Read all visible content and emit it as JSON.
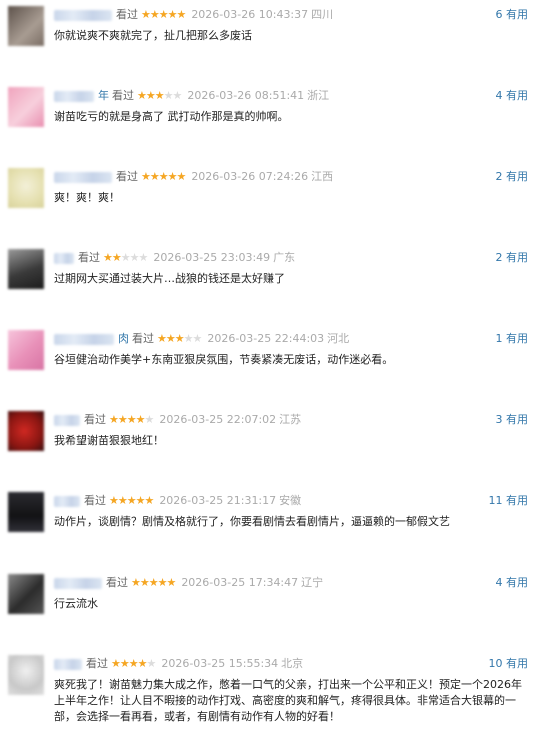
{
  "comments": [
    {
      "user_tail": "",
      "name_w": 58,
      "watched": "看过",
      "stars": 5,
      "time": "2026-03-26 10:43:37",
      "location": "四川",
      "useful_count": "6",
      "useful_label": "有用",
      "content": "你就说爽不爽就完了，扯几把那么多废话",
      "avatar": [
        "#5d524b",
        "#a89c92"
      ]
    },
    {
      "user_tail": "年",
      "name_w": 40,
      "watched": "看过",
      "stars": 3,
      "time": "2026-03-26 08:51:41",
      "location": "浙江",
      "useful_count": "4",
      "useful_label": "有用",
      "content": "谢苗吃亏的就是身高了 武打动作那是真的帅啊。",
      "avatar": [
        "#f0a3bd",
        "#f7cfdc"
      ]
    },
    {
      "user_tail": "",
      "name_w": 58,
      "watched": "看过",
      "stars": 5,
      "time": "2026-03-26 07:24:26",
      "location": "江西",
      "useful_count": "2",
      "useful_label": "有用",
      "content": "爽！爽！爽！",
      "avatar": [
        "#e5e0b0",
        "#f3f0d8"
      ]
    },
    {
      "user_tail": "",
      "name_w": 20,
      "watched": "看过",
      "stars": 2,
      "time": "2026-03-25 23:03:49",
      "location": "广东",
      "useful_count": "2",
      "useful_label": "有用",
      "content": "过期网大买通过装大片…战狼的钱还是太好赚了",
      "avatar": [
        "#3a3a3a",
        "#9a9a9a"
      ]
    },
    {
      "user_tail": "肉",
      "name_w": 60,
      "watched": "看过",
      "stars": 3,
      "time": "2026-03-25 22:44:03",
      "location": "河北",
      "useful_count": "1",
      "useful_label": "有用",
      "content": "谷垣健治动作美学+东南亚狠戾氛围，节奏紧凑无废话，动作迷必看。",
      "avatar": [
        "#e890b8",
        "#f6c4db"
      ]
    },
    {
      "user_tail": "看",
      "name_w": 26,
      "watched": "过",
      "stars": 4,
      "time": "2026-03-25 22:07:02",
      "location": "江苏",
      "useful_count": "3",
      "useful_label": "有用",
      "content": "我希望谢苗狠狠地红！",
      "avatar": [
        "#b0201c",
        "#3a1010"
      ]
    },
    {
      "user_tail": "看",
      "name_w": 26,
      "watched": "过",
      "stars": 5,
      "time": "2026-03-25 21:31:17",
      "location": "安徽",
      "useful_count": "11",
      "useful_label": "有用",
      "content": "动作片，谈剧情？剧情及格就行了，你要看剧情去看剧情片，逼逼赖的一郁假文艺",
      "avatar": [
        "#1a1a1c",
        "#3c3c44"
      ]
    },
    {
      "user_tail": "",
      "name_w": 48,
      "watched": "看过",
      "stars": 5,
      "time": "2026-03-25 17:34:47",
      "location": "辽宁",
      "useful_count": "4",
      "useful_label": "有用",
      "content": "行云流水",
      "avatar": [
        "#2c2c2c",
        "#8a8a8a"
      ]
    },
    {
      "user_tail": "",
      "name_w": 28,
      "watched": "看过",
      "stars": 4,
      "time": "2026-03-25 15:55:34",
      "location": "北京",
      "useful_count": "10",
      "useful_label": "有用",
      "content": "爽死我了！谢苗魅力集大成之作，憋着一口气的父亲，打出来一个公平和正义！预定一个2026年上半年之作！让人目不暇接的动作打戏、高密度的爽和解气，疼得很具体。非常适合大银幕的一部，会选择一看再看，或者，有剧情有动作有人物的好看！",
      "avatar": [
        "#c8c8c8",
        "#f0f0f0"
      ]
    }
  ]
}
